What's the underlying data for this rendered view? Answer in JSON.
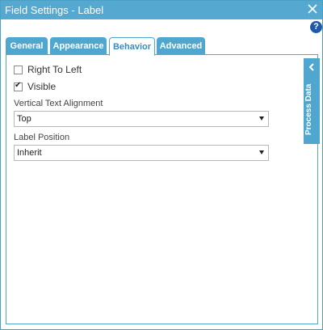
{
  "window": {
    "title": "Field Settings - Label",
    "close_icon": "close-icon",
    "help_label": "?",
    "accent_color": "#55a8d0"
  },
  "tabs": [
    {
      "label": "General",
      "active": false
    },
    {
      "label": "Appearance",
      "active": false
    },
    {
      "label": "Behavior",
      "active": true
    },
    {
      "label": "Advanced",
      "active": false
    }
  ],
  "behavior": {
    "right_to_left": {
      "label": "Right To Left",
      "checked": false
    },
    "visible": {
      "label": "Visible",
      "checked": true
    },
    "vertical_text_alignment": {
      "label": "Vertical Text Alignment",
      "value": "Top"
    },
    "label_position": {
      "label": "Label Position",
      "value": "Inherit"
    }
  },
  "side_panel": {
    "label": "Process Data",
    "icon": "chevron-left-icon"
  }
}
